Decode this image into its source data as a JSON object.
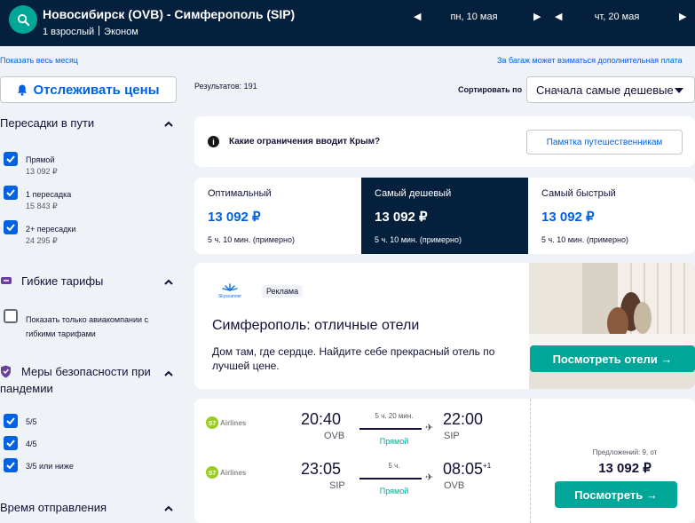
{
  "header": {
    "route": "Новосибирск (OVB) - Симферополь (SIP)",
    "passengers": "1 взрослый",
    "cabin": "Эконом",
    "depart_date": "пн, 10 мая",
    "return_date": "чт, 20 мая"
  },
  "links": {
    "show_month": "Показать весь месяц",
    "baggage_note": "За багаж может взиматься дополнительная плата"
  },
  "track_prices": "Отслеживать цены",
  "filters": {
    "stops": {
      "title": "Пересадки в пути",
      "options": [
        {
          "label": "Прямой",
          "price": "13 092 ₽",
          "checked": true
        },
        {
          "label": "1 пересадка",
          "price": "15 843 ₽",
          "checked": true
        },
        {
          "label": "2+ пересадки",
          "price": "24 295 ₽",
          "checked": true
        }
      ]
    },
    "flex": {
      "title": "Гибкие тарифы",
      "option": "Показать только авиакомпании с гибкими тарифами"
    },
    "safety": {
      "title_line1": "Меры безопасности при",
      "title_line2": "пандемии",
      "options": [
        "5/5",
        "4/5",
        "3/5 или ниже"
      ]
    },
    "departure_time": {
      "title": "Время отправления"
    }
  },
  "results_count": "Результатов: 191",
  "sort": {
    "label": "Сортировать по",
    "value": "Сначала самые дешевые"
  },
  "crimea": {
    "question": "Какие ограничения вводит Крым?",
    "button": "Памятка путешественникам"
  },
  "tabs": [
    {
      "title": "Оптимальный",
      "price": "13 092 ₽",
      "duration": "5 ч. 10 мин. (примерно)"
    },
    {
      "title": "Самый дешевый",
      "price": "13 092 ₽",
      "duration": "5 ч. 10 мин. (примерно)"
    },
    {
      "title": "Самый быстрый",
      "price": "13 092 ₽",
      "duration": "5 ч. 10 мин. (примерно)"
    }
  ],
  "ad": {
    "brand": "Skyscanner",
    "badge": "Реклама",
    "headline": "Симферополь: отличные отели",
    "body": "Дом там, где сердце. Найдите себе прекрасный отель по лучшей цене.",
    "button": "Посмотреть отели →"
  },
  "flight": {
    "airline": "S7 Airlines",
    "outbound": {
      "dep_time": "20:40",
      "dep_code": "OVB",
      "duration": "5 ч. 20 мин.",
      "stops": "Прямой",
      "arr_time": "22:00",
      "arr_code": "SIP"
    },
    "inbound": {
      "dep_time": "23:05",
      "dep_code": "SIP",
      "duration": "5 ч.",
      "stops": "Прямой",
      "arr_time": "08:05",
      "arr_plus": "+1",
      "arr_code": "OVB"
    },
    "offers": "Предложений: 9, от",
    "price": "13 092 ₽",
    "button": "Посмотреть →"
  },
  "colors": {
    "navy": "#05203c",
    "teal": "#00a698",
    "blue": "#0062e3"
  }
}
